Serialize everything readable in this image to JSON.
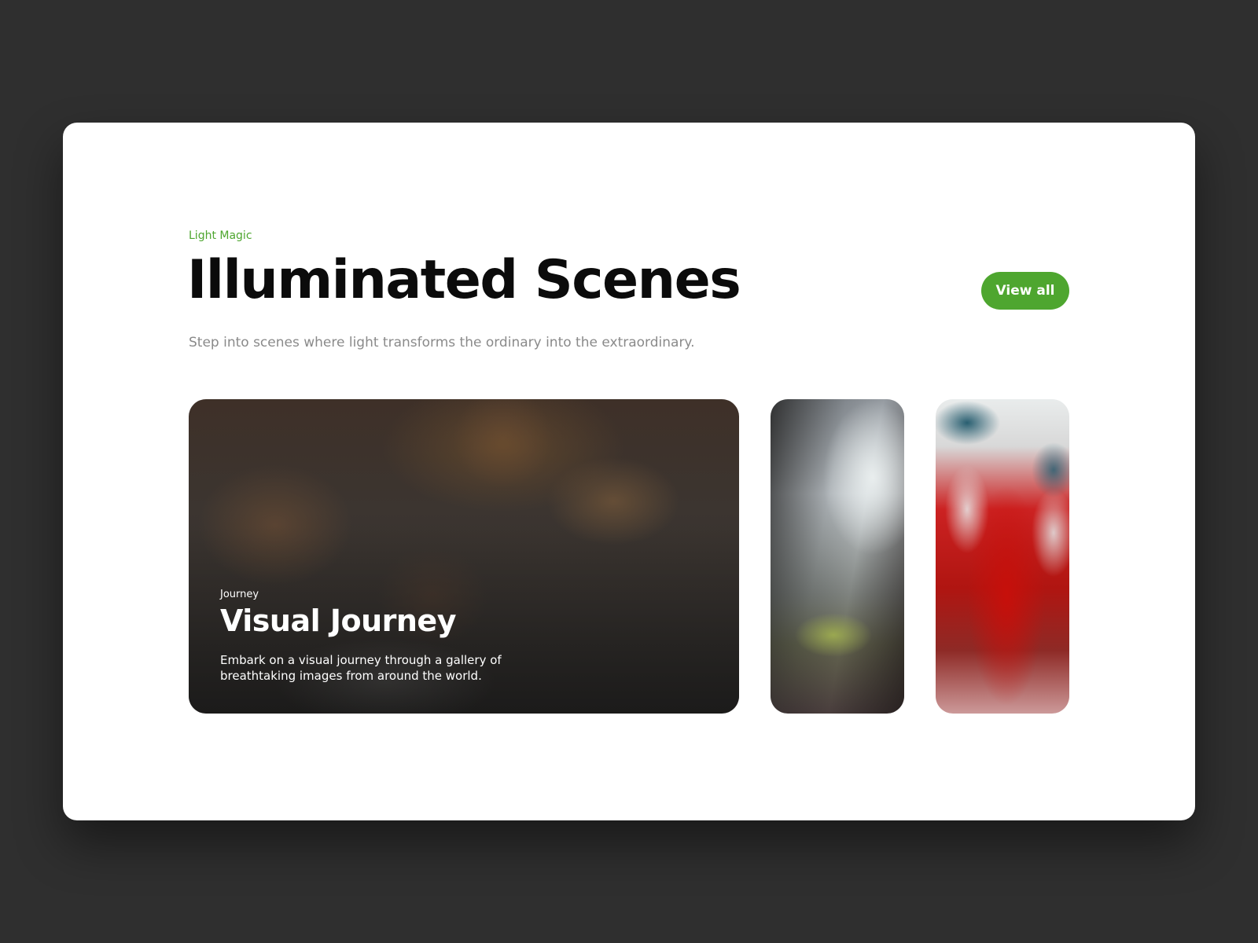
{
  "section": {
    "eyebrow": "Light Magic",
    "title": "Illuminated Scenes",
    "subtitle": "Step into scenes where light transforms the ordinary into the extraordinary.",
    "view_all_label": "View all"
  },
  "tiles": [
    {
      "tag": "Journey",
      "title": "Visual Journey",
      "description": "Embark on a visual journey through a gallery of breathtaking images from around the world."
    }
  ],
  "colors": {
    "accent": "#4ea62f",
    "page_background": "#2f2f2f",
    "card_background": "#ffffff",
    "title_text": "#0b0b0b",
    "subtitle_text": "#8a8a8a"
  }
}
